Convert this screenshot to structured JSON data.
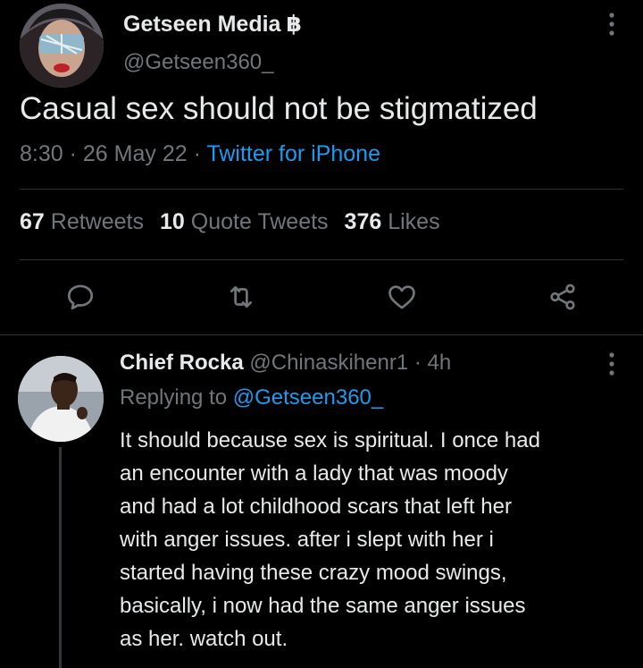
{
  "tweet": {
    "author_name": "Getseen Media",
    "author_badge": "฿",
    "author_handle": "@Getseen360_",
    "text": "Casual sex should not be stigmatized",
    "time": "8:30",
    "date": "26 May 22",
    "separator": "·",
    "source": "Twitter for iPhone",
    "stats": {
      "retweets_count": "67",
      "retweets_label": "Retweets",
      "quotes_count": "10",
      "quotes_label": "Quote Tweets",
      "likes_count": "376",
      "likes_label": "Likes"
    }
  },
  "actions": [
    {
      "icon": "reply-icon"
    },
    {
      "icon": "retweet-icon"
    },
    {
      "icon": "like-icon"
    },
    {
      "icon": "share-icon"
    }
  ],
  "reply": {
    "author_name": "Chief Rocka",
    "author_handle": "@Chinaskihenr1",
    "separator": "·",
    "time_ago": "4h",
    "replying_prefix": "Replying to",
    "replying_handle": "@Getseen360_",
    "lines": [
      "It should because sex is spiritual. I once had",
      "an encounter with a lady that was moody",
      "and had a lot childhood scars that left her",
      "with anger issues. after i slept with her i",
      "started having these crazy mood swings,",
      "basically, i now had the same anger issues",
      "as her. watch out."
    ]
  },
  "colors": {
    "background": "#000000",
    "text": "#e7e9ea",
    "muted": "#71767b",
    "link": "#1d9bf0",
    "divider": "#2f3336"
  }
}
